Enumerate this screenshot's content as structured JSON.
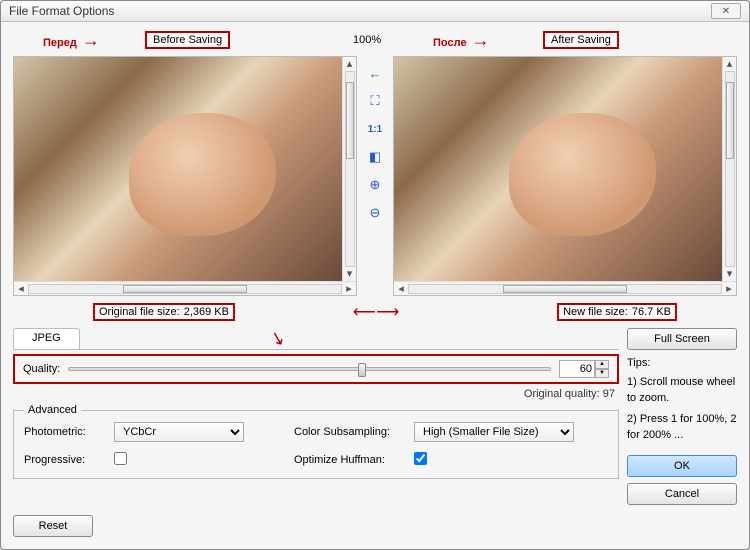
{
  "window": {
    "title": "File Format Options"
  },
  "annotations": {
    "before_ru": "Перед",
    "after_ru": "После",
    "before_label": "Before Saving",
    "after_label": "After Saving",
    "zoom_pct": "100%"
  },
  "tools": {
    "back": "←",
    "fit": "⛶",
    "actual": "1:1",
    "fit2": "◧",
    "zoom_in": "⊕",
    "zoom_out": "⊖"
  },
  "sizes": {
    "orig_label": "Original file size:",
    "orig_value": "2,369 KB",
    "new_label": "New file size:",
    "new_value": "76.7 KB"
  },
  "tabs": {
    "jpeg": "JPEG"
  },
  "quality": {
    "label": "Quality:",
    "value": "60",
    "orig_label": "Original quality: 97"
  },
  "advanced": {
    "legend": "Advanced",
    "photometric_label": "Photometric:",
    "photometric_value": "YCbCr",
    "progressive_label": "Progressive:",
    "subsample_label": "Color Subsampling:",
    "subsample_value": "High (Smaller File Size)",
    "huffman_label": "Optimize Huffman:",
    "huffman_checked": true
  },
  "side": {
    "fullscreen": "Full Screen",
    "tips_hdr": "Tips:",
    "tip1": "1) Scroll mouse wheel to zoom.",
    "tip2": "2) Press 1 for 100%, 2 for 200% ...",
    "ok": "OK",
    "cancel": "Cancel"
  },
  "bottom": {
    "reset": "Reset"
  }
}
